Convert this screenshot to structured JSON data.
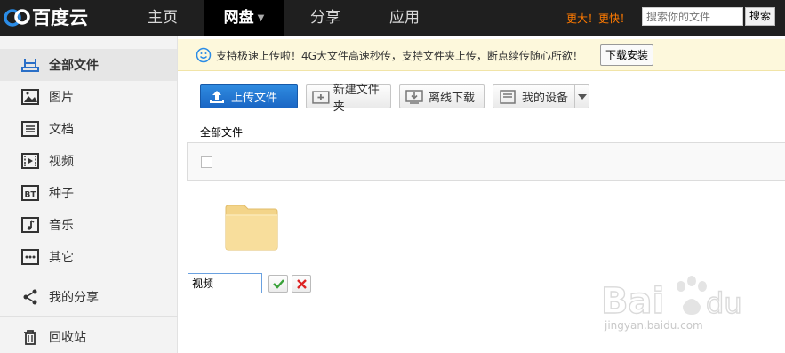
{
  "header": {
    "logo_text": "百度云",
    "nav": [
      {
        "label": "主页"
      },
      {
        "label": "网盘"
      },
      {
        "label": "分享"
      },
      {
        "label": "应用"
      }
    ],
    "promo": "更大！更快！",
    "search": {
      "placeholder": "搜索你的文件",
      "button": "搜索"
    }
  },
  "sidebar": {
    "items": [
      {
        "label": "全部文件",
        "icon": "all-files-icon"
      },
      {
        "label": "图片",
        "icon": "image-icon"
      },
      {
        "label": "文档",
        "icon": "document-icon"
      },
      {
        "label": "视频",
        "icon": "video-icon"
      },
      {
        "label": "种子",
        "icon": "torrent-icon"
      },
      {
        "label": "音乐",
        "icon": "music-icon"
      },
      {
        "label": "其它",
        "icon": "more-icon"
      },
      {
        "label": "我的分享",
        "icon": "share-icon"
      },
      {
        "label": "回收站",
        "icon": "trash-icon"
      }
    ]
  },
  "notice": {
    "text": "支持极速上传啦！4G大文件高速秒传，支持文件夹上传，断点续传随心所欲！",
    "button": "下载安装"
  },
  "toolbar": {
    "upload": "上传文件",
    "new_folder": "新建文件夹",
    "offline_download": "离线下载",
    "my_device": "我的设备"
  },
  "main": {
    "breadcrumb": "全部文件",
    "rename_value": "视频"
  },
  "watermark": {
    "text": "jingyan.baidu.com"
  },
  "colors": {
    "topbar": "#1f1f1f",
    "accent_blue": "#1a66c4",
    "promo_orange": "#ff7a00",
    "notice_bg": "#fdf8dc",
    "sidebar_bg": "#f3f3f3"
  }
}
